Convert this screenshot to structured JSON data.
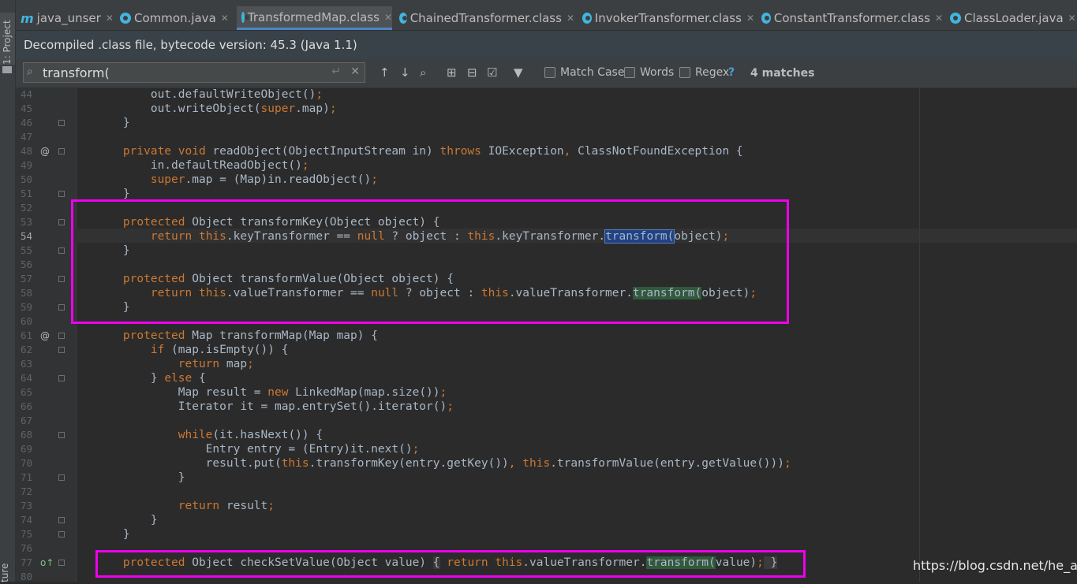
{
  "sidebar": {
    "project_label": "1: Project",
    "bottom_label": "ture"
  },
  "tabs": [
    {
      "label": "java_unser",
      "icon": "module-icon"
    },
    {
      "label": "Common.java",
      "icon": "class-icon"
    },
    {
      "label": "TransformedMap.class",
      "icon": "class-icon",
      "active": true
    },
    {
      "label": "ChainedTransformer.class",
      "icon": "class-icon"
    },
    {
      "label": "InvokerTransformer.class",
      "icon": "class-icon"
    },
    {
      "label": "ConstantTransformer.class",
      "icon": "class-icon"
    },
    {
      "label": "ClassLoader.java",
      "icon": "class-icon"
    }
  ],
  "banner": {
    "text": "Decompiled .class file, bytecode version: 45.3 (Java 1.1)"
  },
  "find": {
    "query": "transform(",
    "match_case": "Match Case",
    "words": "Words",
    "regex": "Regex",
    "help": "?",
    "matches": "4 matches"
  },
  "editor": {
    "current_line": "54",
    "lines": [
      {
        "num": "44",
        "text": "        out.defaultWriteObject();"
      },
      {
        "num": "45",
        "text": "        out.writeObject(super.map);"
      },
      {
        "num": "46",
        "text": "    }"
      },
      {
        "num": "47",
        "text": ""
      },
      {
        "num": "48",
        "text": "    private void readObject(ObjectInputStream in) throws IOException, ClassNotFoundException {",
        "marker": "@"
      },
      {
        "num": "49",
        "text": "        in.defaultReadObject();"
      },
      {
        "num": "50",
        "text": "        super.map = (Map)in.readObject();"
      },
      {
        "num": "51",
        "text": "    }"
      },
      {
        "num": "52",
        "text": ""
      },
      {
        "num": "53",
        "text": "    protected Object transformKey(Object object) {"
      },
      {
        "num": "54",
        "text": "        return this.keyTransformer == null ? object : this.keyTransformer.transform(object);"
      },
      {
        "num": "55",
        "text": "    }"
      },
      {
        "num": "56",
        "text": ""
      },
      {
        "num": "57",
        "text": "    protected Object transformValue(Object object) {"
      },
      {
        "num": "58",
        "text": "        return this.valueTransformer == null ? object : this.valueTransformer.transform(object);"
      },
      {
        "num": "59",
        "text": "    }"
      },
      {
        "num": "60",
        "text": ""
      },
      {
        "num": "61",
        "text": "    protected Map transformMap(Map map) {",
        "marker": "@"
      },
      {
        "num": "62",
        "text": "        if (map.isEmpty()) {"
      },
      {
        "num": "63",
        "text": "            return map;"
      },
      {
        "num": "64",
        "text": "        } else {"
      },
      {
        "num": "65",
        "text": "            Map result = new LinkedMap(map.size());"
      },
      {
        "num": "66",
        "text": "            Iterator it = map.entrySet().iterator();"
      },
      {
        "num": "67",
        "text": ""
      },
      {
        "num": "68",
        "text": "            while(it.hasNext()) {"
      },
      {
        "num": "69",
        "text": "                Entry entry = (Entry)it.next();"
      },
      {
        "num": "70",
        "text": "                result.put(this.transformKey(entry.getKey()), this.transformValue(entry.getValue()));"
      },
      {
        "num": "71",
        "text": "            }"
      },
      {
        "num": "72",
        "text": ""
      },
      {
        "num": "73",
        "text": "            return result;"
      },
      {
        "num": "74",
        "text": "        }"
      },
      {
        "num": "75",
        "text": "    }"
      },
      {
        "num": "76",
        "text": ""
      },
      {
        "num": "77",
        "text": "    protected Object checkSetValue(Object value) { return this.valueTransformer.transform(value); }",
        "marker": "o↑"
      },
      {
        "num": "80",
        "text": ""
      }
    ]
  },
  "watermark": "https://blog.csdn.net/he_and",
  "colors": {
    "background": "#2b2b2b",
    "keyword": "#cc7832",
    "text": "#a9b7c6",
    "current_match": "#214283",
    "match": "#32593d",
    "annotation_box": "#ee00ee"
  }
}
